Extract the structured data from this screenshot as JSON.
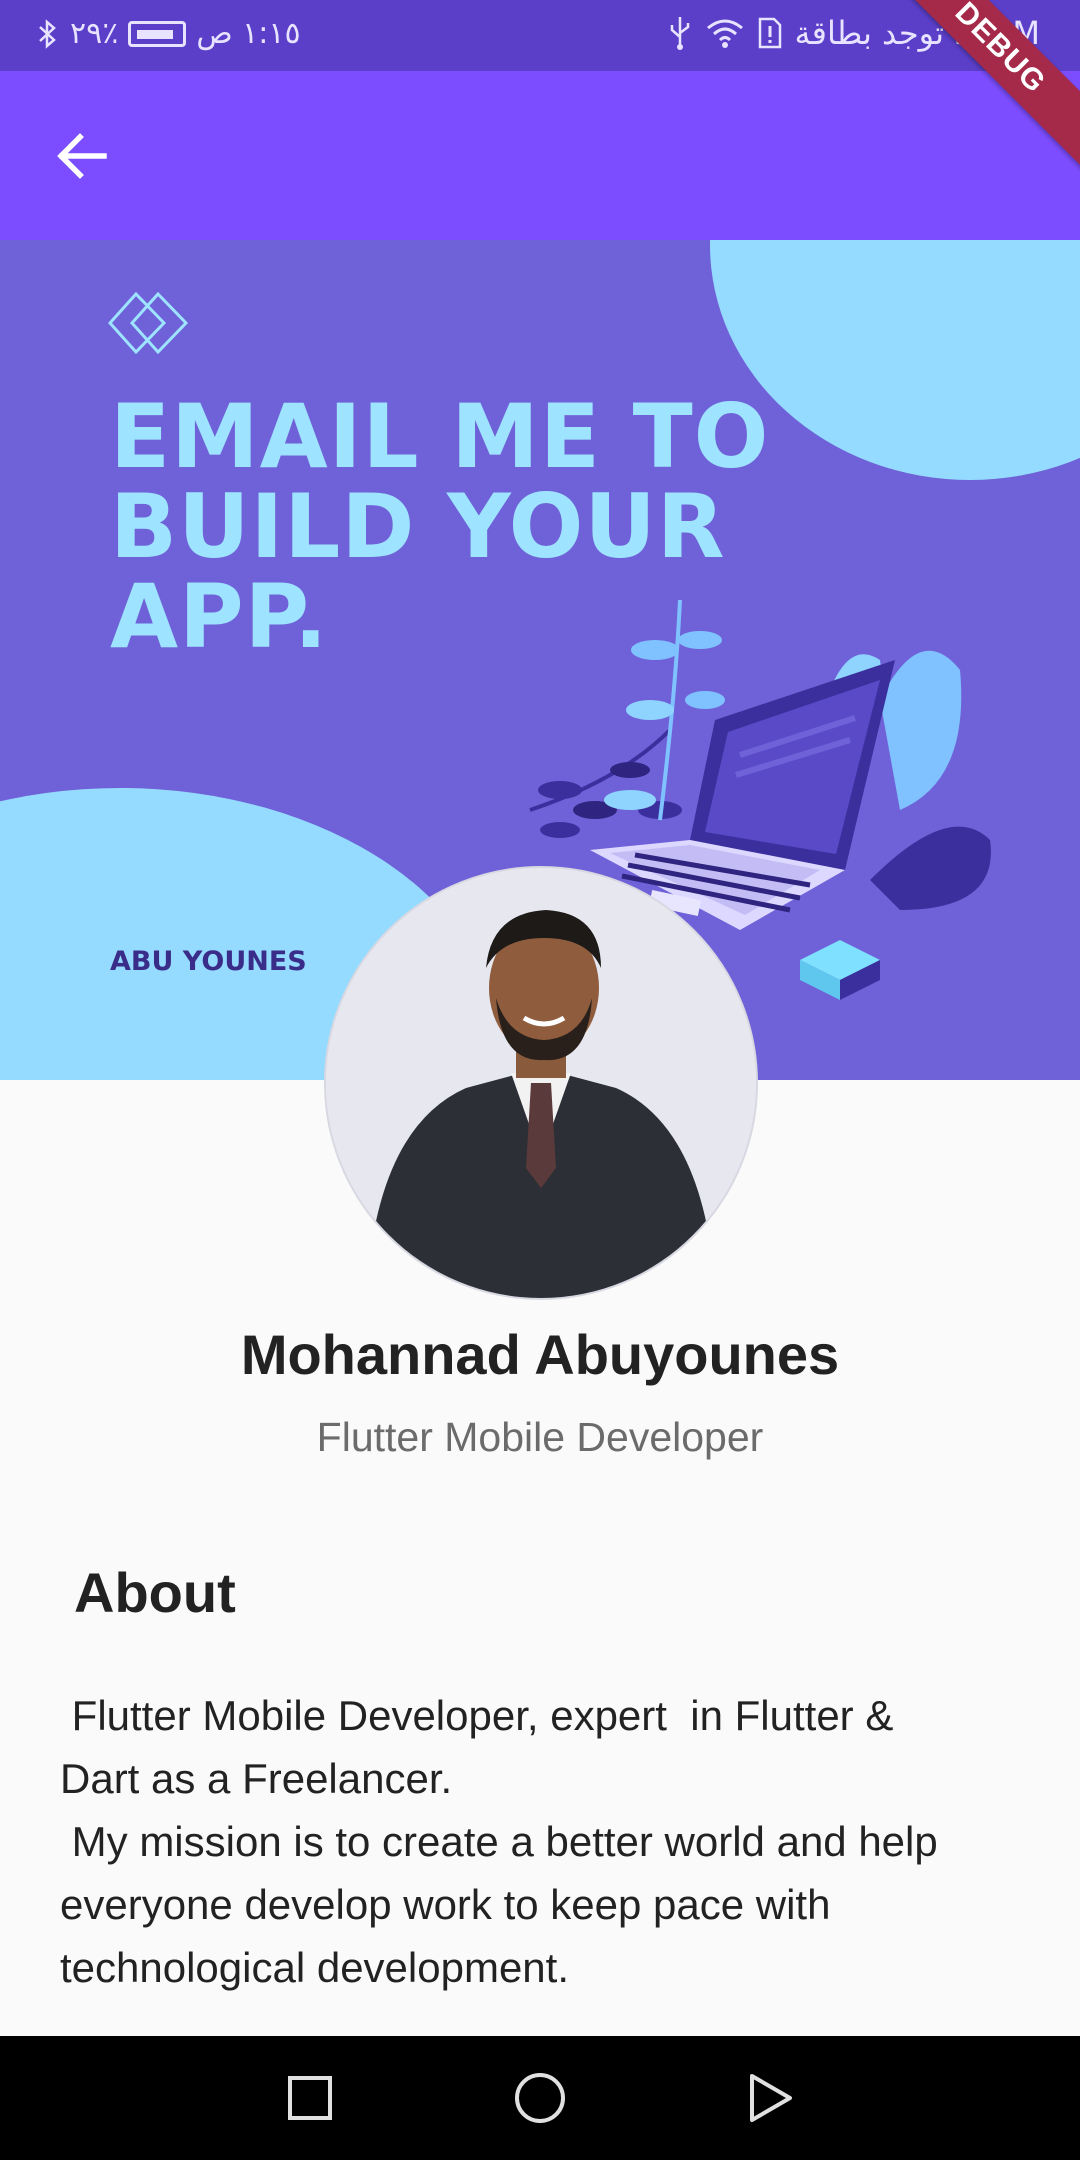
{
  "status_bar": {
    "time": "١:١٥ ص",
    "battery_percent": "٪٢٩",
    "carrier": "لا توجد بطاقة SIM"
  },
  "debug_banner": "DEBUG",
  "banner": {
    "headline_lines": [
      "EMAIL ME TO",
      "BUILD YOUR",
      "APP."
    ],
    "brand": "ABU YOUNES"
  },
  "profile": {
    "name": "Mohannad Abuyounes",
    "title": "Flutter Mobile Developer"
  },
  "about": {
    "heading": "About",
    "lines": [
      " Flutter Mobile Developer, expert  in Flutter &",
      "Dart as a Freelancer.",
      " My mission is to create a better world and help",
      "everyone develop work to keep pace with",
      "technological development."
    ]
  },
  "colors": {
    "app_bar": "#7c4dff",
    "status_bar": "#5b3fc9",
    "banner": "#6f62d8",
    "banner_accent": "#95dbff"
  },
  "icons": {
    "back": "arrow-left-icon",
    "nav_recents": "square-icon",
    "nav_home": "circle-icon",
    "nav_back": "triangle-icon"
  }
}
